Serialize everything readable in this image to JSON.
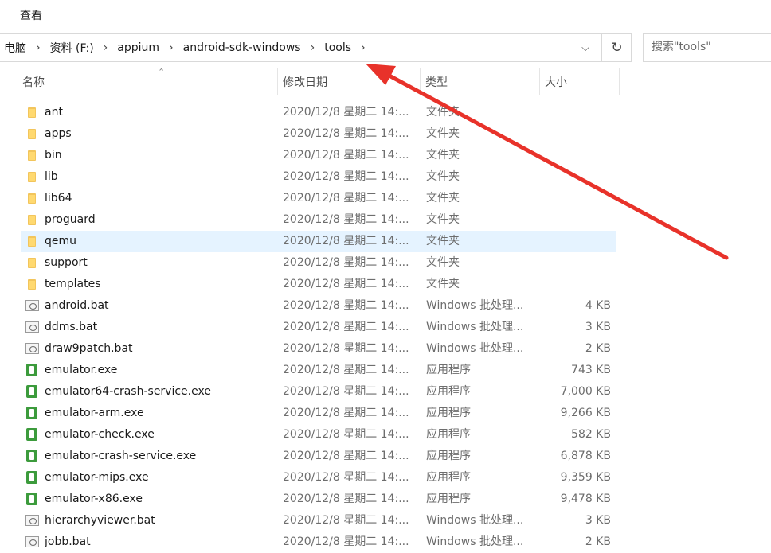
{
  "ribbon": {
    "menu_view": "查看"
  },
  "address": {
    "crumbs": [
      "电脑",
      "资料 (F:)",
      "appium",
      "android-sdk-windows",
      "tools"
    ],
    "separator": "›",
    "dropdown_icon": "chevron-down-icon",
    "refresh_icon": "refresh-icon"
  },
  "search": {
    "placeholder": "搜索\"tools\""
  },
  "columns": {
    "name": "名称",
    "date": "修改日期",
    "type": "类型",
    "size": "大小"
  },
  "annotation": {
    "arrow_color": "#e8322a"
  },
  "selected_color": "#e5f3ff",
  "files": [
    {
      "name": "ant",
      "date": "2020/12/8 星期二 14:...",
      "type": "文件夹",
      "size": "",
      "icon": "folder"
    },
    {
      "name": "apps",
      "date": "2020/12/8 星期二 14:...",
      "type": "文件夹",
      "size": "",
      "icon": "folder"
    },
    {
      "name": "bin",
      "date": "2020/12/8 星期二 14:...",
      "type": "文件夹",
      "size": "",
      "icon": "folder"
    },
    {
      "name": "lib",
      "date": "2020/12/8 星期二 14:...",
      "type": "文件夹",
      "size": "",
      "icon": "folder"
    },
    {
      "name": "lib64",
      "date": "2020/12/8 星期二 14:...",
      "type": "文件夹",
      "size": "",
      "icon": "folder"
    },
    {
      "name": "proguard",
      "date": "2020/12/8 星期二 14:...",
      "type": "文件夹",
      "size": "",
      "icon": "folder"
    },
    {
      "name": "qemu",
      "date": "2020/12/8 星期二 14:...",
      "type": "文件夹",
      "size": "",
      "icon": "folder",
      "selected": true
    },
    {
      "name": "support",
      "date": "2020/12/8 星期二 14:...",
      "type": "文件夹",
      "size": "",
      "icon": "folder"
    },
    {
      "name": "templates",
      "date": "2020/12/8 星期二 14:...",
      "type": "文件夹",
      "size": "",
      "icon": "folder"
    },
    {
      "name": "android.bat",
      "date": "2020/12/8 星期二 14:...",
      "type": "Windows 批处理...",
      "size": "4 KB",
      "icon": "bat"
    },
    {
      "name": "ddms.bat",
      "date": "2020/12/8 星期二 14:...",
      "type": "Windows 批处理...",
      "size": "3 KB",
      "icon": "bat"
    },
    {
      "name": "draw9patch.bat",
      "date": "2020/12/8 星期二 14:...",
      "type": "Windows 批处理...",
      "size": "2 KB",
      "icon": "bat"
    },
    {
      "name": "emulator.exe",
      "date": "2020/12/8 星期二 14:...",
      "type": "应用程序",
      "size": "743 KB",
      "icon": "exe"
    },
    {
      "name": "emulator64-crash-service.exe",
      "date": "2020/12/8 星期二 14:...",
      "type": "应用程序",
      "size": "7,000 KB",
      "icon": "exe"
    },
    {
      "name": "emulator-arm.exe",
      "date": "2020/12/8 星期二 14:...",
      "type": "应用程序",
      "size": "9,266 KB",
      "icon": "exe"
    },
    {
      "name": "emulator-check.exe",
      "date": "2020/12/8 星期二 14:...",
      "type": "应用程序",
      "size": "582 KB",
      "icon": "exe"
    },
    {
      "name": "emulator-crash-service.exe",
      "date": "2020/12/8 星期二 14:...",
      "type": "应用程序",
      "size": "6,878 KB",
      "icon": "exe"
    },
    {
      "name": "emulator-mips.exe",
      "date": "2020/12/8 星期二 14:...",
      "type": "应用程序",
      "size": "9,359 KB",
      "icon": "exe"
    },
    {
      "name": "emulator-x86.exe",
      "date": "2020/12/8 星期二 14:...",
      "type": "应用程序",
      "size": "9,478 KB",
      "icon": "exe"
    },
    {
      "name": "hierarchyviewer.bat",
      "date": "2020/12/8 星期二 14:...",
      "type": "Windows 批处理...",
      "size": "3 KB",
      "icon": "bat"
    },
    {
      "name": "jobb.bat",
      "date": "2020/12/8 星期二 14:...",
      "type": "Windows 批处理...",
      "size": "2 KB",
      "icon": "bat"
    }
  ]
}
